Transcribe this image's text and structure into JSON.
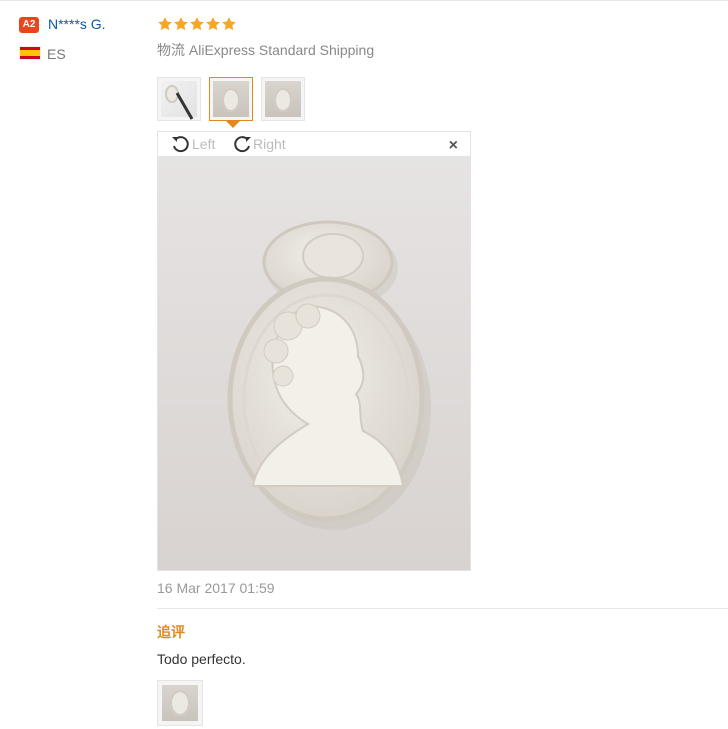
{
  "user": {
    "level_badge": "A2",
    "name": "N****s G.",
    "country_code": "ES",
    "flag_icon": "spain-flag-icon"
  },
  "feedback": {
    "rating": 5,
    "rating_max": 5,
    "star_color": "#f5a623",
    "shipping": "物流 AliExpress Standard Shipping",
    "photos": [
      {
        "name": "photo-thumb-1",
        "selected": false
      },
      {
        "name": "photo-thumb-2",
        "selected": true
      },
      {
        "name": "photo-thumb-3",
        "selected": false
      }
    ],
    "viewer": {
      "rotate_left_label": "Left",
      "rotate_right_label": "Right",
      "close_label": "×"
    },
    "date": "16 Mar 2017 01:59"
  },
  "additional_feedback": {
    "title": "追评",
    "text": "Todo perfecto.",
    "accent_color": "#e08a1e",
    "photos": [
      {
        "name": "additional-photo-thumb-1"
      }
    ]
  }
}
